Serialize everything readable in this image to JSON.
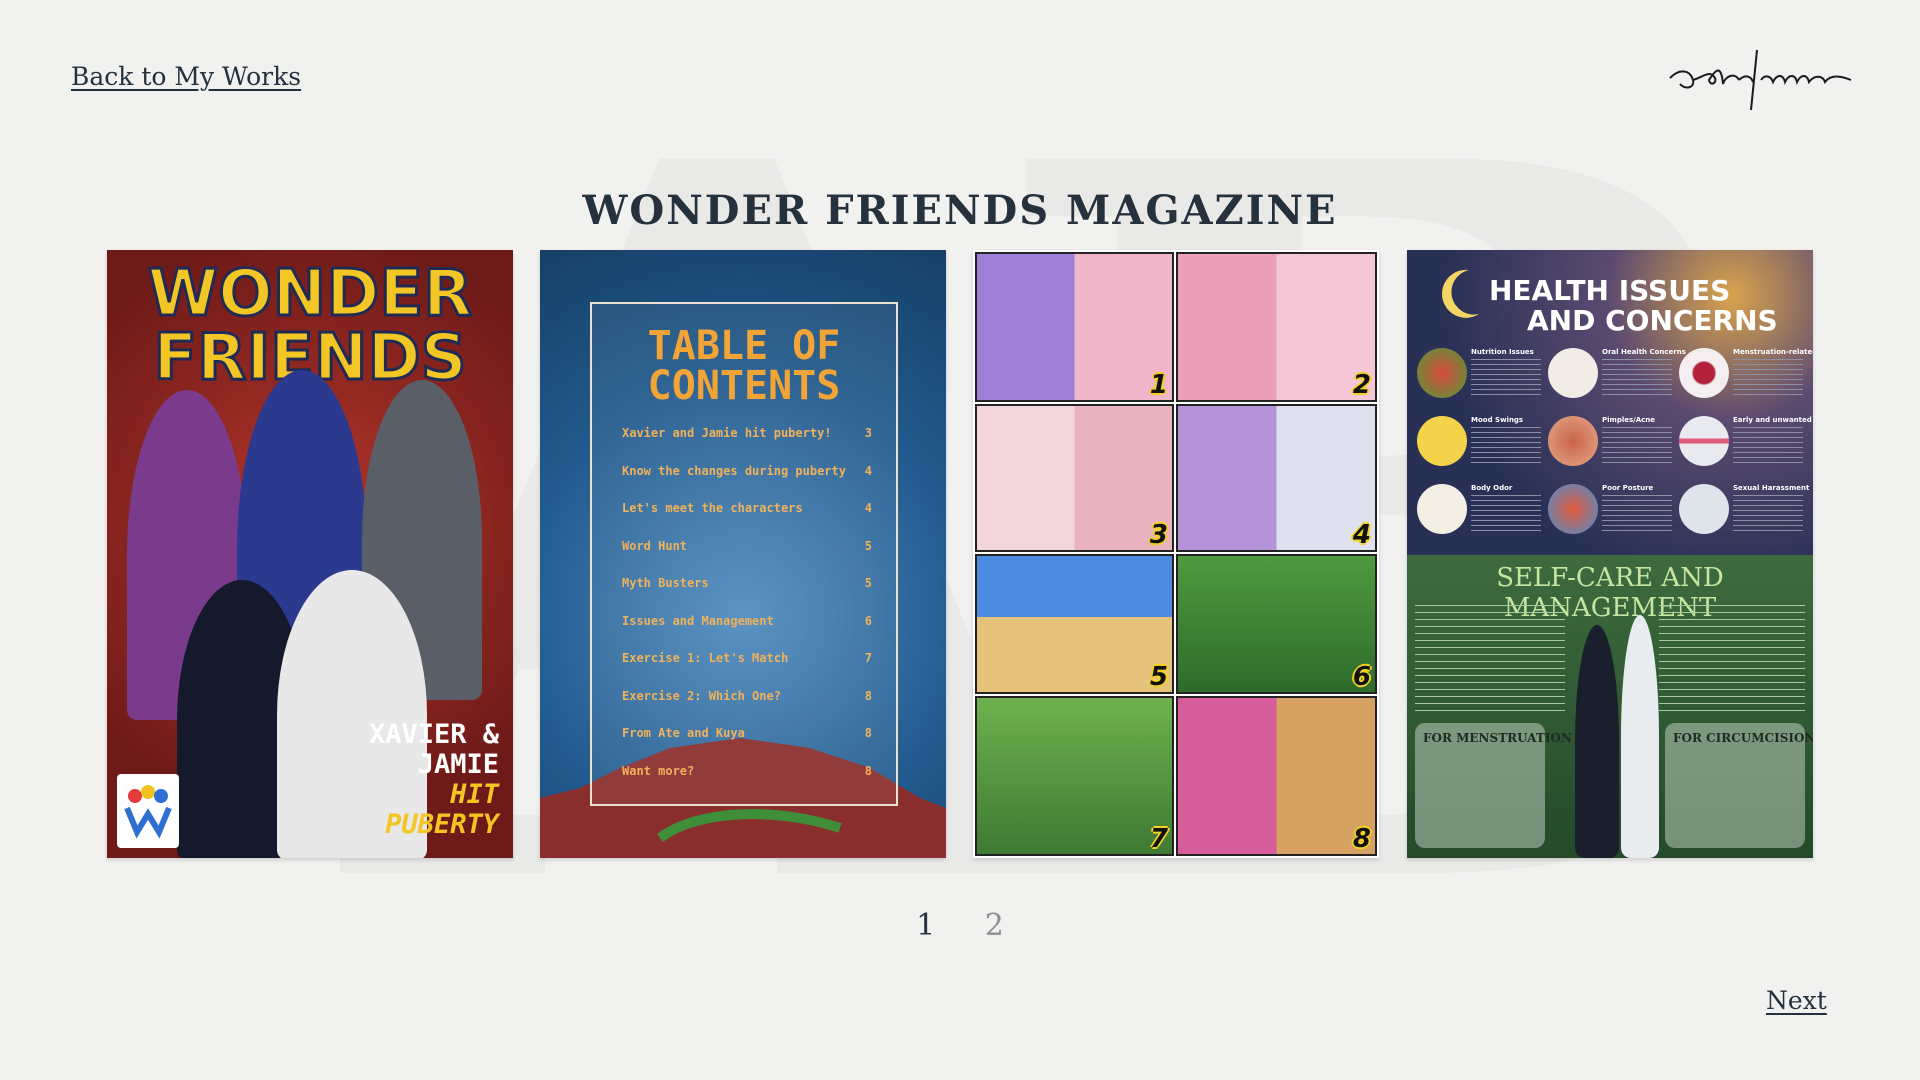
{
  "nav": {
    "back_label": "Back to My Works",
    "next_label": "Next"
  },
  "brand": {
    "signature_text": "adrianne"
  },
  "page": {
    "title": "WONDER FRIENDS MAGAZINE"
  },
  "gallery": {
    "cards": [
      {
        "title_line1": "WONDER",
        "title_line2": "FRIENDS",
        "subtitle_line1": "XAVIER &",
        "subtitle_line2": "JAMIE",
        "subtitle_line3": "HIT",
        "subtitle_line4": "PUBERTY"
      },
      {
        "title_line1": "TABLE OF",
        "title_line2": "CONTENTS",
        "items": [
          {
            "label": "Xavier and Jamie hit puberty!",
            "page": "3"
          },
          {
            "label": "Know the changes during puberty",
            "page": "4"
          },
          {
            "label": "Let's meet the characters",
            "page": "4"
          },
          {
            "label": "Word Hunt",
            "page": "5"
          },
          {
            "label": "Myth Busters",
            "page": "5"
          },
          {
            "label": "Issues and Management",
            "page": "6"
          },
          {
            "label": "Exercise 1: Let's Match",
            "page": "7"
          },
          {
            "label": "Exercise 2: Which One?",
            "page": "8"
          },
          {
            "label": "From Ate and Kuya",
            "page": "8"
          },
          {
            "label": "Want more?",
            "page": "8"
          }
        ]
      },
      {
        "panel_numbers": [
          "1",
          "2",
          "3",
          "4",
          "5",
          "6",
          "7",
          "8"
        ]
      },
      {
        "title_line1": "HEALTH ISSUES",
        "title_line2": "AND CONCERNS",
        "items": [
          "Nutrition Issues",
          "Oral Health Concerns",
          "Menstruation-related Concerns",
          "Mood Swings",
          "Pimples/Acne",
          "Early and unwanted pregnancy",
          "Body Odor",
          "Poor Posture",
          "Sexual Harassment"
        ],
        "care_title": "SELF-CARE AND MANAGEMENT",
        "care_box1": "FOR MENSTRUATION",
        "care_box2": "FOR CIRCUMCISION"
      }
    ]
  },
  "pagination": {
    "pages": [
      "1",
      "2"
    ],
    "current": "1"
  },
  "colors": {
    "text": "#24323f",
    "background": "#f1f1f0",
    "inactive_page": "#8a9096"
  }
}
